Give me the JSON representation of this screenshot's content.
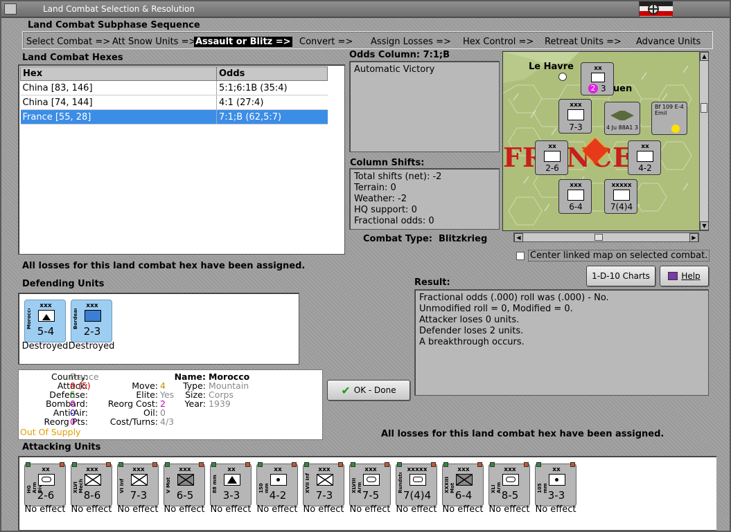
{
  "window": {
    "title": "Land Combat Selection & Resolution"
  },
  "subphase": {
    "title": "Land Combat Subphase Sequence",
    "phases": [
      "Select Combat =>",
      "Att Snow Units =>",
      "Assault or Blitz =>",
      "Convert =>",
      "Assign Losses =>",
      "Hex Control =>",
      "Retreat Units =>",
      "Advance Units"
    ],
    "active_index": 2
  },
  "hexes": {
    "title": "Land Combat Hexes",
    "columns": [
      "Hex",
      "Odds"
    ],
    "rows": [
      {
        "hex": "China [83, 146]",
        "odds": "5:1;6:1B (35:4)"
      },
      {
        "hex": "China [74, 144]",
        "odds": "4:1 (27:4)"
      },
      {
        "hex": "France [55, 28]",
        "odds": "7:1;B (62,5:7)"
      }
    ],
    "selected_index": 2
  },
  "odds_column": {
    "title": "Odds Column: 7:1;B",
    "text": "Automatic Victory"
  },
  "column_shifts": {
    "title": "Column Shifts:",
    "lines": [
      "Total shifts (net): -2",
      "Terrain: 0",
      "Weather: -2",
      "HQ support: 0",
      "Fractional odds: 0"
    ]
  },
  "combat_type": "Combat Type:  Blitzkrieg",
  "losses_assigned_msg": "All losses for this land combat hex have been assigned.",
  "center_map_label": "Center linked map on selected combat.",
  "buttons": {
    "charts": "1-D-10 Charts",
    "help": "Help",
    "ok": "OK - Done"
  },
  "result": {
    "title": "Result:",
    "lines": [
      "Fractional odds (.000) roll was (.000)  - No.",
      "Unmodified roll = 0, Modified = 0.",
      "Attacker loses 0 units.",
      "Defender loses 2 units.",
      "A breakthrough occurs."
    ]
  },
  "defending": {
    "title": "Defending Units",
    "units": [
      {
        "size": "xxx",
        "name": "Morocco",
        "strength": "5-4",
        "result": "Destroyed",
        "symbol": "mountain"
      },
      {
        "size": "xxx",
        "name": "Bordeaux",
        "strength": "2-3",
        "result": "Destroyed",
        "symbol": "motorized"
      }
    ]
  },
  "unit_info": {
    "country_k": "Country:",
    "country_v": "France",
    "attack_k": "Attack:",
    "attack_v": "0",
    "attack_v2": "(5)",
    "defense_k": "Defense:",
    "defense_v": "5",
    "bombard_k": "Bombard:",
    "bombard_v": "0",
    "antiair_k": "Anti-Air:",
    "antiair_v": "0",
    "reorgpts_k": "Reorg Pts:",
    "reorgpts_v": "0",
    "supply": "Out Of Supply",
    "move_k": "Move:",
    "move_v": "4",
    "elite_k": "Elite:",
    "elite_v": "Yes",
    "reorgcost_k": "Reorg Cost:",
    "reorgcost_v": "2",
    "oil_k": "Oil:",
    "oil_v": "0",
    "costturns_k": "Cost/Turns:",
    "costturns_v": "4/3",
    "name_k": "Name:",
    "name_v": "Morocco",
    "type_k": "Type:",
    "type_v": "Mountain",
    "size_k": "Size:",
    "size_v": "Corps",
    "year_k": "Year:",
    "year_v": "1939"
  },
  "attacking": {
    "title": "Attacking Units",
    "units": [
      {
        "size": "xx",
        "name": "HG Arm Div",
        "strength": "2-6",
        "result": "No effect",
        "symbol": "armor"
      },
      {
        "size": "xxx",
        "name": "XLVI Mech",
        "strength": "8-6",
        "result": "No effect",
        "symbol": "mech"
      },
      {
        "size": "xxx",
        "name": "VI Inf",
        "strength": "7-3",
        "result": "No effect",
        "symbol": "infantry"
      },
      {
        "size": "xxx",
        "name": "V Mot",
        "strength": "6-5",
        "result": "No effect",
        "symbol": "motorized"
      },
      {
        "size": "xx",
        "name": "88 mm",
        "strength": "3-3",
        "result": "No effect",
        "symbol": "antiair"
      },
      {
        "size": "xx",
        "name": "150 mm",
        "strength": "4-2",
        "result": "No effect",
        "symbol": "artillery"
      },
      {
        "size": "xxx",
        "name": "XVII Inf",
        "strength": "7-3",
        "result": "No effect",
        "symbol": "infantry"
      },
      {
        "size": "xxx",
        "name": "XLVIII Arm",
        "strength": "7-5",
        "result": "No effect",
        "symbol": "armor"
      },
      {
        "size": "xxxxx",
        "name": "Rundstedt",
        "strength": "7(4)4",
        "result": "No effect",
        "symbol": "hq"
      },
      {
        "size": "xxx",
        "name": "XXXIII Mot",
        "strength": "6-4",
        "result": "No effect",
        "symbol": "motorized"
      },
      {
        "size": "xxx",
        "name": "XLI Arm",
        "strength": "8-5",
        "result": "No effect",
        "symbol": "armor"
      },
      {
        "size": "xx",
        "name": "105 mm",
        "strength": "3-3",
        "result": "No effect",
        "symbol": "artillery"
      }
    ]
  },
  "map": {
    "city_label": "Le Havre",
    "city2_label": "ouen",
    "country_label": "FRANCE",
    "stacks": [
      {
        "size": "xx",
        "strength": "3",
        "badge": "2"
      },
      {
        "size": "xxx",
        "strength": "7-3"
      },
      {
        "size": "",
        "strength": "4 Ju 88A1 3"
      },
      {
        "size": "",
        "strength": "Bf 109 E-4 Emil"
      },
      {
        "size": "xx",
        "strength": "2-6"
      },
      {
        "size": "xx",
        "strength": "4-2"
      },
      {
        "size": "xxx",
        "strength": "6-4"
      },
      {
        "size": "xxxxx",
        "strength": "7(4)4"
      }
    ]
  },
  "colors": {
    "selection": "#3c8de6",
    "defender_counter": "#9dcdf0",
    "attacker_counter": "#b6b6b6",
    "attack_red": "#d40000",
    "defense_green": "#1a8a1a",
    "bombard_magenta": "#c000c0",
    "supply_orange": "#e0a000"
  }
}
